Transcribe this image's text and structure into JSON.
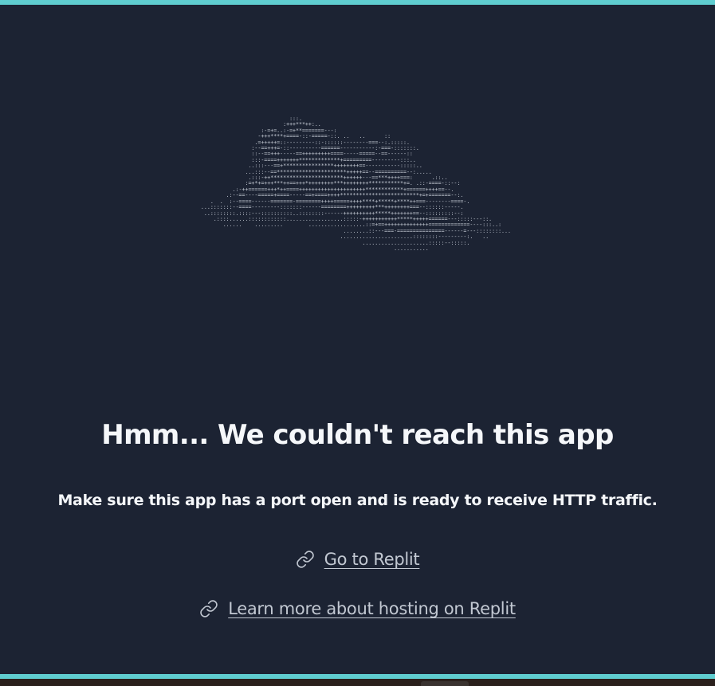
{
  "ascii_art": {
    "lines": [
      "                               :::.",
      "                             :+++***++:..",
      "                      :-=+=..:-=+**=======---:",
      "                     -+++****+====-::-=====-::. ..   ..      ::",
      "                    .=+++++=::---------::-::::::--------===--:.:::::.",
      "                   :--==+++=-::----------======-----------:-===-:::::::.",
      "                   ::--==+++-----==+++++++++====-----=====--==------::",
      "                   :::-====+++++++*************+=========---------:::..",
      "                  ..:::---==+****************++++++++==-----------:::::..",
      "                 ...:::--==**********************+++++==--==========--:.....",
      "                  .:::-++***********************++++++---==***++++===:      .::..",
      "                 :=+*+=+++***++==+++*++++++++***++++++++***********+=. .::-====-::--:",
      "             .:-++======+++*++====+++++++++++++++++++++************+======++++==--.",
      "           .:--==----=====+====-----==+====++++*************************+=+=======--:.",
      "      .  .  :--====------=======-========++++=====++++****+*****+****++===--------====-.",
      "   ...:::::::--====---------:::::::------========+++++++++***++++++++===--::::::-----.",
      "    ..::::::::.::::---::::::::::..::::::::------++++++++++*****+++++++==--:::::::::--:",
      "       .::::......::::::::::::..................:::::-+++++++++++*****+++++======---:::::---::.",
      "          ......    .........        ..................::=+==++++++++++++++=============----:::..:",
      "                                                ........::---===-===============------=---::::::::...",
      "                                               .......................::::::::---------:.   ..",
      "                                                      .....................:::::--:::::.",
      "                                                                ..........."
    ]
  },
  "title": "Hmm... We couldn't reach this app",
  "subtitle": "Make sure this app has a port open and is ready to receive HTTP traffic.",
  "links": {
    "replit": {
      "label": "Go to Replit",
      "icon": "link-icon"
    },
    "hosting": {
      "label": "Learn more about hosting on Replit",
      "icon": "link-icon"
    }
  },
  "colors": {
    "background": "#1c2333",
    "accent_border": "#5fcdd0",
    "text_primary": "#f5f7fa",
    "text_link": "#c2c8d2"
  }
}
